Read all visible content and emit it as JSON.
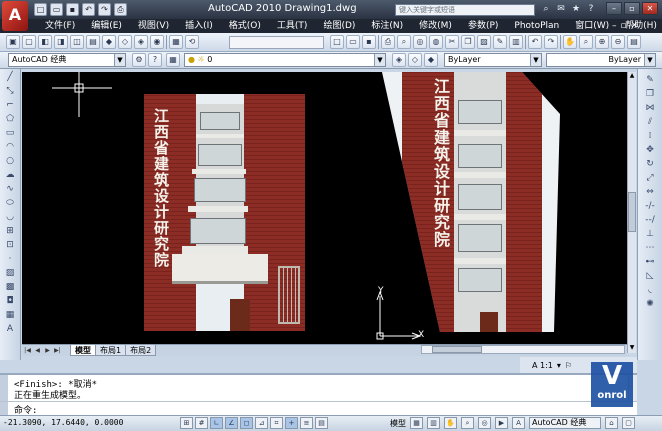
{
  "app": {
    "logo_letter": "A",
    "title": "AutoCAD 2010   Drawing1.dwg",
    "search_placeholder": "键入关键字或短语"
  },
  "menus": [
    "文件(F)",
    "编辑(E)",
    "视图(V)",
    "插入(I)",
    "格式(O)",
    "工具(T)",
    "绘图(D)",
    "标注(N)",
    "修改(M)",
    "参数(P)",
    "PhotoPlan",
    "窗口(W)",
    "帮助(H)",
    "点云"
  ],
  "toolbar2": {
    "workspace": "AutoCAD 经典",
    "layer": "0",
    "color": "ByLayer",
    "linetype": "ByLayer"
  },
  "layout_tabs": [
    "模型",
    "布局1",
    "布局2"
  ],
  "command": {
    "line1": "<Finish>:  *取消*",
    "line2": "正在重生成模型。",
    "prompt": "命令:"
  },
  "status": {
    "coords": "-21.3090, 17.6440, 0.0000",
    "model_label": "模型",
    "annotation_scale": "A 1:1",
    "workspace": "AutoCAD 经典"
  },
  "ucs": {
    "x_label": "X",
    "y_label": "Y"
  },
  "watermark": {
    "text": "onrol"
  },
  "building_sign_chars": [
    "江",
    "西",
    "省",
    "建",
    "筑",
    "设",
    "计",
    "研",
    "究",
    "院"
  ],
  "icons": {
    "qat": [
      "new-icon",
      "open-icon",
      "save-icon",
      "undo-icon",
      "redo-icon",
      "plot-icon"
    ],
    "window": [
      "minimize-icon",
      "restore-icon",
      "close-icon"
    ]
  }
}
